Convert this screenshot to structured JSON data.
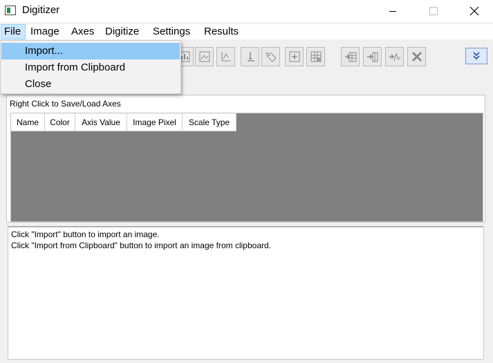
{
  "window": {
    "title": "Digitizer",
    "controls": {
      "minimize": "minimize",
      "maximize": "maximize",
      "close": "close"
    }
  },
  "menubar": {
    "items": [
      "File",
      "Image",
      "Axes",
      "Digitize",
      "Settings",
      "Results"
    ],
    "active": "File"
  },
  "file_menu": {
    "items": [
      "Import...",
      "Import from Clipboard",
      "Close"
    ],
    "highlighted": "Import..."
  },
  "toolbar": {
    "icons": [
      "chart-icon",
      "image-icon",
      "axis-icon",
      "bar-icon",
      "tag-icon",
      "point-icon",
      "grid-icon",
      "add-table-icon",
      "add-column-icon",
      "add-curve-icon",
      "delete-icon"
    ],
    "expand_icon": "double-chevron-down-icon"
  },
  "axes": {
    "caption": "Right Click to Save/Load Axes",
    "columns": [
      "Name",
      "Color",
      "Axis Value",
      "Image Pixel",
      "Scale Type"
    ]
  },
  "log": {
    "lines": [
      "Click \"Import\" button to import an image.",
      "Click \"Import from Clipboard\" button to import an image from clipboard."
    ]
  },
  "colors": {
    "menu_highlight": "#91c9f7",
    "menu_active": "#cce8ff",
    "grid_background": "#808080",
    "window_background": "#f0f0f0"
  }
}
